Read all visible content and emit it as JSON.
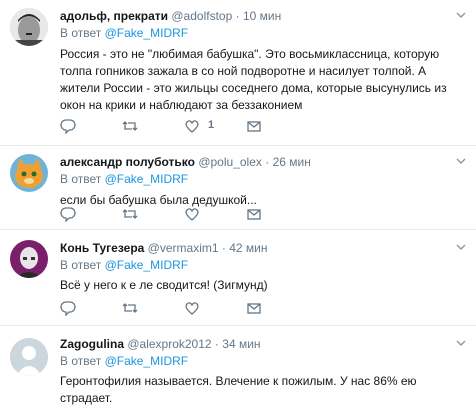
{
  "tweets": [
    {
      "name": "адольф, прекрати",
      "handle": "@adolfstop",
      "dot": "·",
      "time": "10 мин",
      "reply_prefix": "В ответ ",
      "reply_to": "@Fake_MIDRF",
      "text": "Россия - это не \"любимая бабушка\". Это восьмиклассница, которую толпа гопников зажала в со ной подворотне и насилует толпой. А жители России - это жильцы соседнего дома, которые высунулись из окон на крики и наблюдают за беззаконием",
      "like_count": "1"
    },
    {
      "name": "александр полуботько",
      "handle": "@polu_olex",
      "dot": "·",
      "time": "26 мин",
      "reply_prefix": "В ответ ",
      "reply_to": "@Fake_MIDRF",
      "text": "если бы бабушка была дедушкой..."
    },
    {
      "name": "Конь Тугезера",
      "handle": "@vermaxim1",
      "dot": "·",
      "time": "42 мин",
      "reply_prefix": "В ответ ",
      "reply_to": "@Fake_MIDRF",
      "text": "Всё у него к е ле сводится! (Зигмунд)"
    },
    {
      "name": "Zagogulina",
      "handle": "@alexprok2012",
      "dot": "·",
      "time": "34 мин",
      "reply_prefix": "В ответ ",
      "reply_to": "@Fake_MIDRF",
      "text": "Геронтофилия называется. Влечение к пожилым. У нас 86% ею страдает."
    }
  ],
  "icons": {
    "reply": "reply-icon",
    "retweet": "retweet-icon",
    "like": "heart-icon",
    "dm": "envelope-icon",
    "caret": "chevron-down-icon"
  },
  "colors": {
    "link": "#1b95e0",
    "secondary": "#657786",
    "divider": "#e6ecf0"
  }
}
